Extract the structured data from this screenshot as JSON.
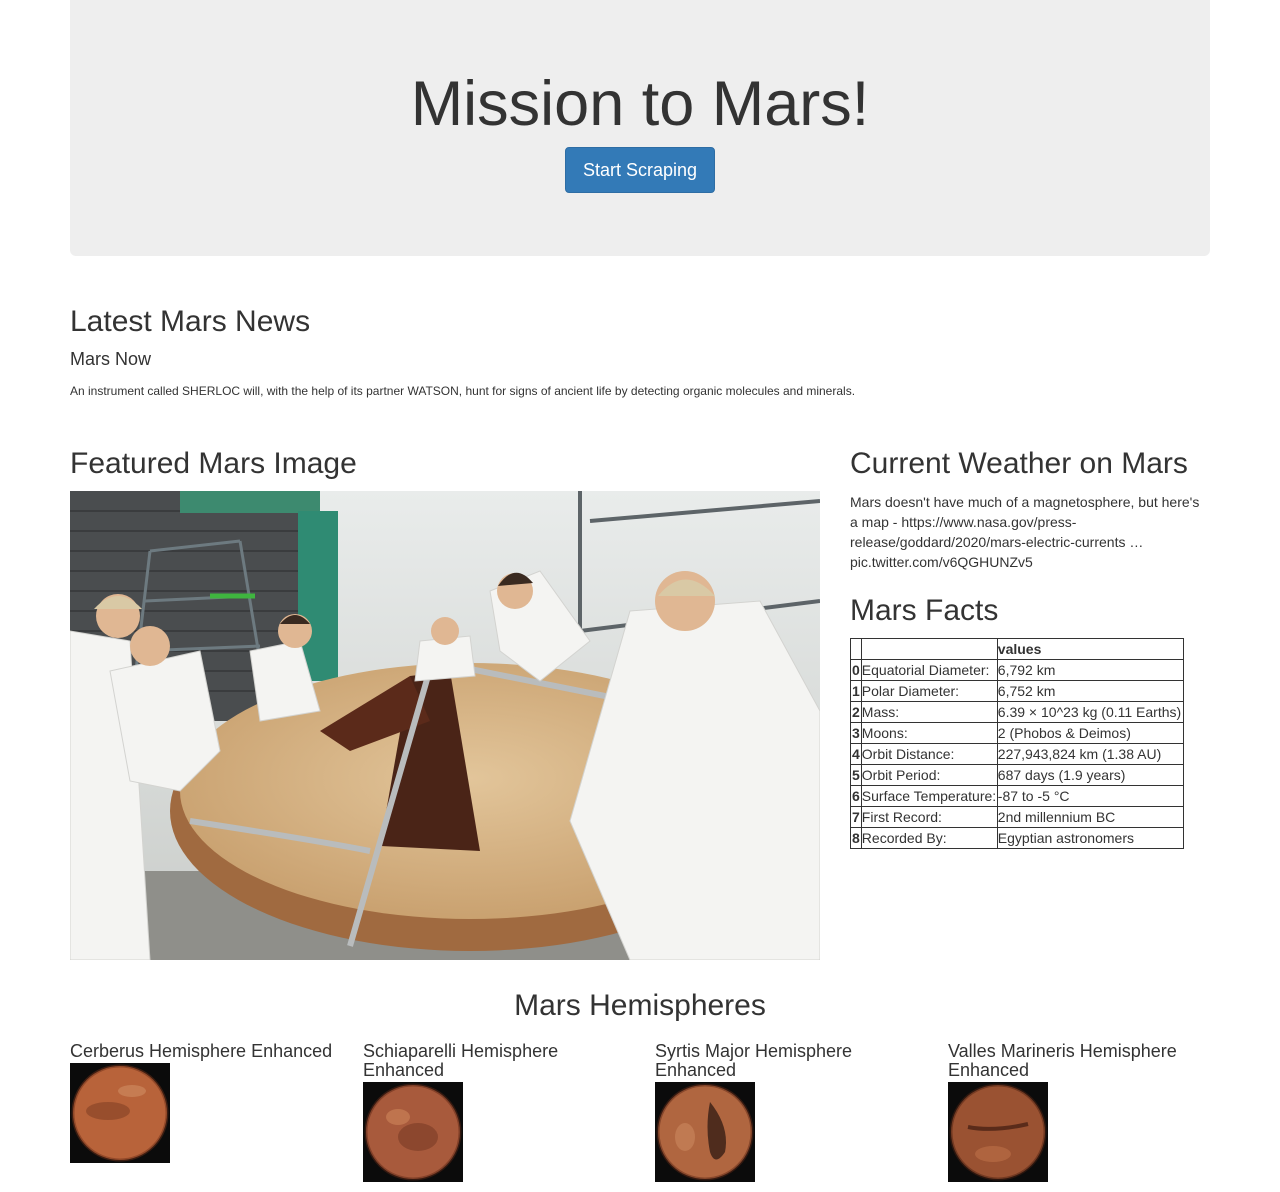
{
  "header": {
    "title": "Mission to Mars!",
    "scrape_button": "Start Scraping"
  },
  "news": {
    "section_title": "Latest Mars News",
    "headline": "Mars Now",
    "paragraph": "An instrument called SHERLOC will, with the help of its partner WATSON, hunt for signs of ancient life by detecting organic molecules and minerals."
  },
  "featured": {
    "section_title": "Featured Mars Image",
    "image_alt": "Technicians working on a heat shield in a clean room"
  },
  "weather": {
    "section_title": "Current Weather on Mars",
    "text": "Mars doesn't have much of a magnetosphere, but here's a map - https://www.nasa.gov/press-release/goddard/2020/mars-electric-currents … pic.twitter.com/v6QGHUNZv5"
  },
  "facts": {
    "section_title": "Mars Facts",
    "column_header": "values",
    "rows": [
      {
        "index": "0",
        "label": "Equatorial Diameter:",
        "value": "6,792 km"
      },
      {
        "index": "1",
        "label": "Polar Diameter:",
        "value": "6,752 km"
      },
      {
        "index": "2",
        "label": "Mass:",
        "value": "6.39 × 10^23 kg (0.11 Earths)"
      },
      {
        "index": "3",
        "label": "Moons:",
        "value": "2 (Phobos & Deimos)"
      },
      {
        "index": "4",
        "label": "Orbit Distance:",
        "value": "227,943,824 km (1.38 AU)"
      },
      {
        "index": "5",
        "label": "Orbit Period:",
        "value": "687 days (1.9 years)"
      },
      {
        "index": "6",
        "label": "Surface Temperature:",
        "value": "-87 to -5 °C"
      },
      {
        "index": "7",
        "label": "First Record:",
        "value": "2nd millennium BC"
      },
      {
        "index": "8",
        "label": "Recorded By:",
        "value": "Egyptian astronomers"
      }
    ]
  },
  "hemispheres": {
    "section_title": "Mars Hemispheres",
    "items": [
      {
        "title": "Cerberus Hemisphere Enhanced",
        "icon": "mars-globe-image",
        "accent": "#b8633a"
      },
      {
        "title": "Schiaparelli Hemisphere Enhanced",
        "icon": "mars-globe-image",
        "accent": "#a85a3c"
      },
      {
        "title": "Syrtis Major Hemisphere Enhanced",
        "icon": "mars-globe-image",
        "accent": "#b06640"
      },
      {
        "title": "Valles Marineris Hemisphere Enhanced",
        "icon": "mars-globe-image",
        "accent": "#9a5232"
      }
    ]
  },
  "colors": {
    "primary_button": "#337ab7",
    "jumbotron_bg": "#eeeeee",
    "text": "#333333"
  }
}
